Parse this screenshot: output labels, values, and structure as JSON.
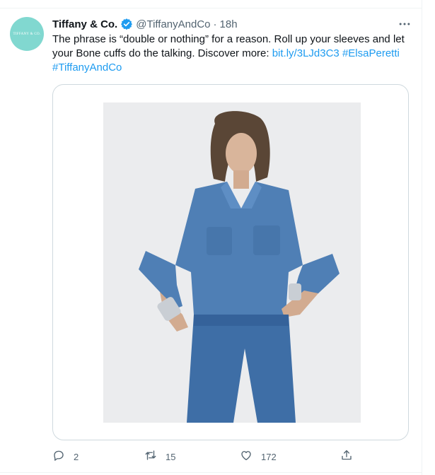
{
  "author": {
    "name": "Tiffany & Co.",
    "handle": "@TiffanyAndCo",
    "avatar_text": "Tiffany & Co.",
    "verified": true
  },
  "time": "18h",
  "separator": "·",
  "tweet": {
    "text": "The phrase is “double or nothing” for a reason. Roll up your sleeves and let your Bone cuffs do the talking. Discover more: ",
    "link": "bit.ly/3LJd3C3",
    "hashtag_1": "#ElsaPeretti",
    "hashtag_2": "#TiffanyAndCo"
  },
  "actions": {
    "reply_count": "2",
    "retweet_count": "15",
    "like_count": "172"
  },
  "icons": {
    "verified": "verified-badge-icon",
    "more": "more-dots-icon",
    "reply": "reply-icon",
    "retweet": "retweet-icon",
    "like": "heart-icon",
    "share": "share-icon"
  },
  "colors": {
    "accent": "#1d9bf0",
    "avatar_bg": "#81d8d0",
    "muted": "#536471",
    "text": "#0f1419"
  }
}
